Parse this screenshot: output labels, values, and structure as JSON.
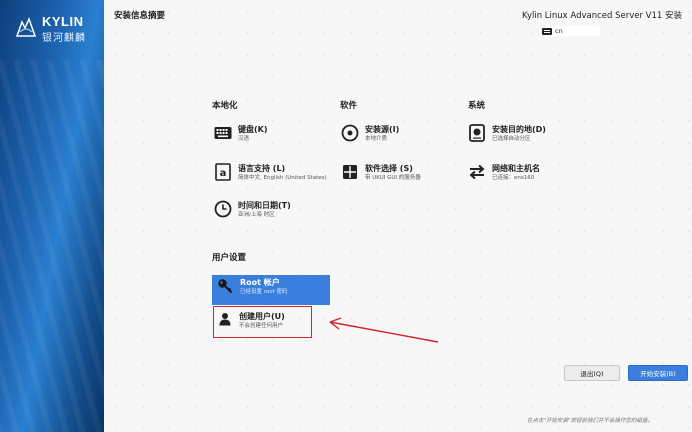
{
  "brand": {
    "name_en": "KYLIN",
    "name_cn": "银河麒麟"
  },
  "header": {
    "page_title": "安装信息摘要",
    "product_title": "Kylin Linux Advanced Server V11 安装",
    "keyboard_indicator": "cn"
  },
  "categories": {
    "localization": "本地化",
    "software": "软件",
    "system": "系统",
    "user_settings": "用户设置"
  },
  "spokes": {
    "keyboard": {
      "title": "键盘(K)",
      "status": "汉语",
      "icon": "keyboard-icon"
    },
    "language": {
      "title": "语言支持 (L)",
      "status": "简体中文, English (United States)",
      "icon": "language-icon"
    },
    "time": {
      "title": "时间和日期(T)",
      "status": "亚洲/上海 时区",
      "icon": "clock-icon"
    },
    "source": {
      "title": "安装源(I)",
      "status": "本地介质",
      "icon": "disc-icon"
    },
    "software_selection": {
      "title": "软件选择 (S)",
      "status": "带 UKUI GUI 的服务器",
      "icon": "package-icon"
    },
    "destination": {
      "title": "安装目的地(D)",
      "status": "已选择自动分区",
      "icon": "harddisk-icon"
    },
    "network": {
      "title": "网络和主机名",
      "status": "已连接：ens160",
      "icon": "network-arrows-icon"
    },
    "root": {
      "title": "Root 帐户",
      "status": "已经设置 root 密码",
      "icon": "key-icon"
    },
    "user": {
      "title": "创建用户(U)",
      "status": "不会创建任何用户",
      "icon": "user-icon"
    }
  },
  "footer": {
    "quit_label": "退出(Q)",
    "begin_label": "开始安装(B)",
    "note": "在点击\"开始安装\"按钮前我们并不会操作您的磁盘。"
  },
  "colors": {
    "accent": "#3b7fde",
    "highlight_border": "#d0252a",
    "sidebar": "#1d63b0"
  }
}
